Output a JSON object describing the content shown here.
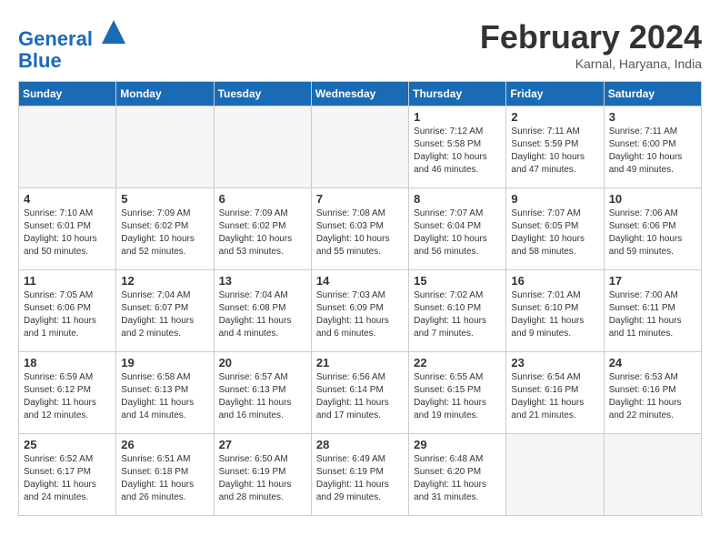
{
  "header": {
    "logo_line1": "General",
    "logo_line2": "Blue",
    "month": "February 2024",
    "location": "Karnal, Haryana, India"
  },
  "days_of_week": [
    "Sunday",
    "Monday",
    "Tuesday",
    "Wednesday",
    "Thursday",
    "Friday",
    "Saturday"
  ],
  "weeks": [
    [
      {
        "num": "",
        "info": "",
        "empty": true
      },
      {
        "num": "",
        "info": "",
        "empty": true
      },
      {
        "num": "",
        "info": "",
        "empty": true
      },
      {
        "num": "",
        "info": "",
        "empty": true
      },
      {
        "num": "1",
        "info": "Sunrise: 7:12 AM\nSunset: 5:58 PM\nDaylight: 10 hours\nand 46 minutes.",
        "empty": false
      },
      {
        "num": "2",
        "info": "Sunrise: 7:11 AM\nSunset: 5:59 PM\nDaylight: 10 hours\nand 47 minutes.",
        "empty": false
      },
      {
        "num": "3",
        "info": "Sunrise: 7:11 AM\nSunset: 6:00 PM\nDaylight: 10 hours\nand 49 minutes.",
        "empty": false
      }
    ],
    [
      {
        "num": "4",
        "info": "Sunrise: 7:10 AM\nSunset: 6:01 PM\nDaylight: 10 hours\nand 50 minutes.",
        "empty": false
      },
      {
        "num": "5",
        "info": "Sunrise: 7:09 AM\nSunset: 6:02 PM\nDaylight: 10 hours\nand 52 minutes.",
        "empty": false
      },
      {
        "num": "6",
        "info": "Sunrise: 7:09 AM\nSunset: 6:02 PM\nDaylight: 10 hours\nand 53 minutes.",
        "empty": false
      },
      {
        "num": "7",
        "info": "Sunrise: 7:08 AM\nSunset: 6:03 PM\nDaylight: 10 hours\nand 55 minutes.",
        "empty": false
      },
      {
        "num": "8",
        "info": "Sunrise: 7:07 AM\nSunset: 6:04 PM\nDaylight: 10 hours\nand 56 minutes.",
        "empty": false
      },
      {
        "num": "9",
        "info": "Sunrise: 7:07 AM\nSunset: 6:05 PM\nDaylight: 10 hours\nand 58 minutes.",
        "empty": false
      },
      {
        "num": "10",
        "info": "Sunrise: 7:06 AM\nSunset: 6:06 PM\nDaylight: 10 hours\nand 59 minutes.",
        "empty": false
      }
    ],
    [
      {
        "num": "11",
        "info": "Sunrise: 7:05 AM\nSunset: 6:06 PM\nDaylight: 11 hours\nand 1 minute.",
        "empty": false
      },
      {
        "num": "12",
        "info": "Sunrise: 7:04 AM\nSunset: 6:07 PM\nDaylight: 11 hours\nand 2 minutes.",
        "empty": false
      },
      {
        "num": "13",
        "info": "Sunrise: 7:04 AM\nSunset: 6:08 PM\nDaylight: 11 hours\nand 4 minutes.",
        "empty": false
      },
      {
        "num": "14",
        "info": "Sunrise: 7:03 AM\nSunset: 6:09 PM\nDaylight: 11 hours\nand 6 minutes.",
        "empty": false
      },
      {
        "num": "15",
        "info": "Sunrise: 7:02 AM\nSunset: 6:10 PM\nDaylight: 11 hours\nand 7 minutes.",
        "empty": false
      },
      {
        "num": "16",
        "info": "Sunrise: 7:01 AM\nSunset: 6:10 PM\nDaylight: 11 hours\nand 9 minutes.",
        "empty": false
      },
      {
        "num": "17",
        "info": "Sunrise: 7:00 AM\nSunset: 6:11 PM\nDaylight: 11 hours\nand 11 minutes.",
        "empty": false
      }
    ],
    [
      {
        "num": "18",
        "info": "Sunrise: 6:59 AM\nSunset: 6:12 PM\nDaylight: 11 hours\nand 12 minutes.",
        "empty": false
      },
      {
        "num": "19",
        "info": "Sunrise: 6:58 AM\nSunset: 6:13 PM\nDaylight: 11 hours\nand 14 minutes.",
        "empty": false
      },
      {
        "num": "20",
        "info": "Sunrise: 6:57 AM\nSunset: 6:13 PM\nDaylight: 11 hours\nand 16 minutes.",
        "empty": false
      },
      {
        "num": "21",
        "info": "Sunrise: 6:56 AM\nSunset: 6:14 PM\nDaylight: 11 hours\nand 17 minutes.",
        "empty": false
      },
      {
        "num": "22",
        "info": "Sunrise: 6:55 AM\nSunset: 6:15 PM\nDaylight: 11 hours\nand 19 minutes.",
        "empty": false
      },
      {
        "num": "23",
        "info": "Sunrise: 6:54 AM\nSunset: 6:16 PM\nDaylight: 11 hours\nand 21 minutes.",
        "empty": false
      },
      {
        "num": "24",
        "info": "Sunrise: 6:53 AM\nSunset: 6:16 PM\nDaylight: 11 hours\nand 22 minutes.",
        "empty": false
      }
    ],
    [
      {
        "num": "25",
        "info": "Sunrise: 6:52 AM\nSunset: 6:17 PM\nDaylight: 11 hours\nand 24 minutes.",
        "empty": false
      },
      {
        "num": "26",
        "info": "Sunrise: 6:51 AM\nSunset: 6:18 PM\nDaylight: 11 hours\nand 26 minutes.",
        "empty": false
      },
      {
        "num": "27",
        "info": "Sunrise: 6:50 AM\nSunset: 6:19 PM\nDaylight: 11 hours\nand 28 minutes.",
        "empty": false
      },
      {
        "num": "28",
        "info": "Sunrise: 6:49 AM\nSunset: 6:19 PM\nDaylight: 11 hours\nand 29 minutes.",
        "empty": false
      },
      {
        "num": "29",
        "info": "Sunrise: 6:48 AM\nSunset: 6:20 PM\nDaylight: 11 hours\nand 31 minutes.",
        "empty": false
      },
      {
        "num": "",
        "info": "",
        "empty": true
      },
      {
        "num": "",
        "info": "",
        "empty": true
      }
    ]
  ]
}
